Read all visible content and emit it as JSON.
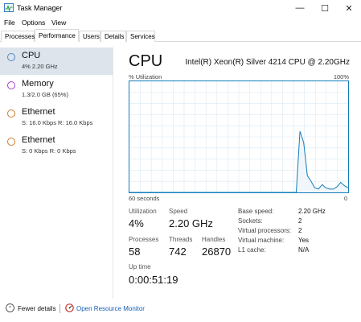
{
  "window": {
    "title": "Task Manager",
    "icon": "task-manager-icon",
    "minimize_glyph": "—",
    "maximize_glyph": "☐",
    "close_glyph": "✕"
  },
  "menu": {
    "file": "File",
    "options": "Options",
    "view": "View"
  },
  "tabs": {
    "processes": "Processes",
    "performance": "Performance",
    "users": "Users",
    "details": "Details",
    "services": "Services",
    "active": "Performance"
  },
  "sidebar": {
    "items": [
      {
        "title": "CPU",
        "subtitle": "4% 2.20 GHz",
        "ring_color": "#4e8ac6",
        "selected": true
      },
      {
        "title": "Memory",
        "subtitle": "1.3/2.0 GB (65%)",
        "ring_color": "#a33ed1",
        "selected": false
      },
      {
        "title": "Ethernet",
        "subtitle": "S: 16.0 Kbps R: 16.0 Kbps",
        "ring_color": "#d27a2b",
        "selected": false
      },
      {
        "title": "Ethernet",
        "subtitle": "S: 0 Kbps R: 0 Kbps",
        "ring_color": "#d27a2b",
        "selected": false
      }
    ]
  },
  "main": {
    "title": "CPU",
    "cpu_name": "Intel(R) Xeon(R) Silver 4214 CPU @ 2.20GHz",
    "util_label": "% Utilization",
    "util_max": "100%",
    "time_label": "60 seconds",
    "time_zero": "0",
    "graph_line_color": "#117dbb",
    "graph_fill_color": "#f1f6fa",
    "graph_grid_color": "#d9eaf4"
  },
  "stats": {
    "utilization_label": "Utilization",
    "utilization_value": "4%",
    "speed_label": "Speed",
    "speed_value": "2.20 GHz",
    "processes_label": "Processes",
    "processes_value": "58",
    "threads_label": "Threads",
    "threads_value": "742",
    "handles_label": "Handles",
    "handles_value": "26870",
    "uptime_label": "Up time",
    "uptime_value": "0:00:51:19"
  },
  "specs": {
    "base_speed_label": "Base speed:",
    "base_speed_value": "2.20 GHz",
    "sockets_label": "Sockets:",
    "sockets_value": "2",
    "virtual_processors_label": "Virtual processors:",
    "virtual_processors_value": "2",
    "virtual_machine_label": "Virtual machine:",
    "virtual_machine_value": "Yes",
    "l1_cache_label": "L1 cache:",
    "l1_cache_value": "N/A"
  },
  "footer": {
    "fewer_details": "Fewer details",
    "resource_monitor": "Open Resource Monitor"
  },
  "chart_data": {
    "type": "area",
    "series": [
      {
        "values": [
          0,
          0,
          0,
          0,
          0,
          0,
          0,
          0,
          0,
          0,
          0,
          0,
          0,
          0,
          0,
          0,
          0,
          0,
          0,
          0,
          0,
          0,
          0,
          0,
          0,
          0,
          0,
          0,
          0,
          0,
          0,
          0,
          0,
          0,
          0,
          0,
          0,
          0,
          0,
          0,
          0,
          0,
          0,
          0,
          0,
          0,
          55,
          45,
          15,
          10,
          4,
          3,
          7,
          4,
          3,
          3,
          5,
          9,
          6,
          4
        ]
      }
    ],
    "ylim": [
      0,
      100
    ],
    "xlim": [
      60,
      0
    ],
    "grid": true
  }
}
